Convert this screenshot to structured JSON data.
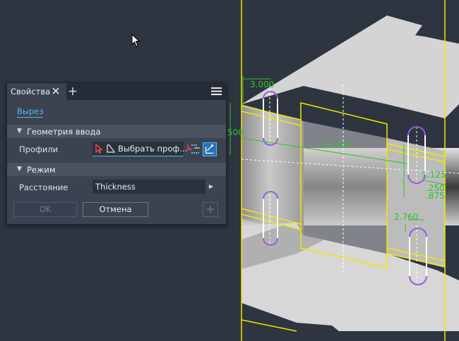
{
  "panel": {
    "tab_label": "Свойства",
    "close_glyph": "✕",
    "add_glyph": "+",
    "operation_link": "Вырез",
    "section_input": "Геометрия ввода",
    "profiles_label": "Профили",
    "profiles_value": "Выбрать проф...",
    "section_mode": "Режим",
    "distance_label": "Расстояние",
    "distance_value": "Thickness",
    "ok_label": "OK",
    "cancel_label": "Отмена",
    "add_button_glyph": "+"
  },
  "dimensions": {
    "d1": "3.000",
    "d2": ".500",
    "d3": "4.250",
    "d4": "1.125",
    "d5": ".250",
    "d6": ".875",
    "d7": "2.760"
  },
  "colors": {
    "background": "#2e3440",
    "sketch_lines": "#f2e800",
    "dimension_text": "#2fc12f",
    "slot_arcs": "#9a5cd6",
    "accent": "#59b6f0"
  }
}
